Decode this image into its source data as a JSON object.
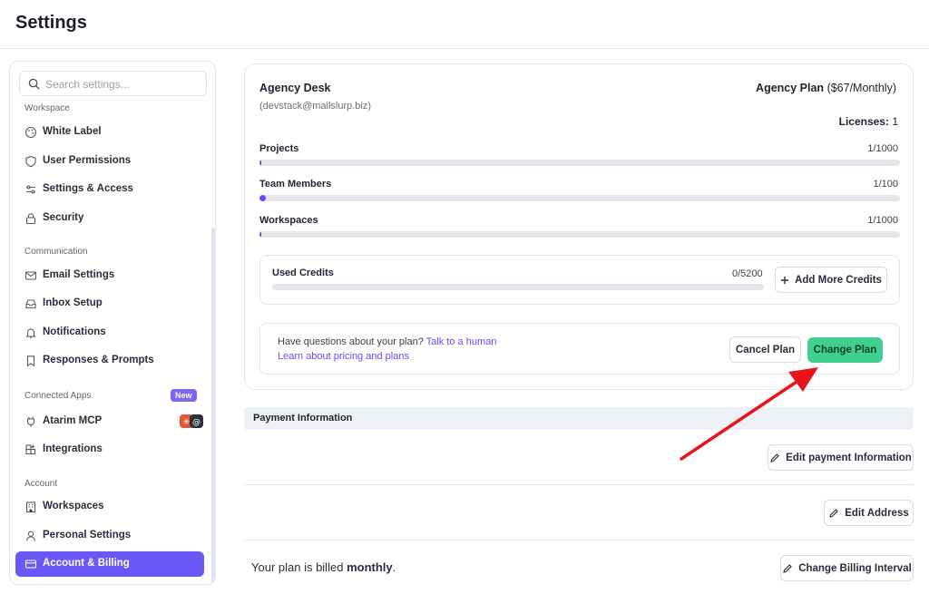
{
  "header": {
    "title": "Settings"
  },
  "sidebar": {
    "search_placeholder": "Search settings...",
    "sections": {
      "workspace": "Workspace",
      "communication": "Communication",
      "connected_apps": "Connected Apps",
      "account": "Account"
    },
    "new_badge": "New",
    "items": [
      {
        "label": "White Label",
        "icon": "palette-icon"
      },
      {
        "label": "User Permissions",
        "icon": "shield-icon"
      },
      {
        "label": "Settings & Access",
        "icon": "sliders-icon"
      },
      {
        "label": "Security",
        "icon": "lock-icon"
      },
      {
        "label": "Email Settings",
        "icon": "mail-icon"
      },
      {
        "label": "Inbox Setup",
        "icon": "inbox-icon"
      },
      {
        "label": "Notifications",
        "icon": "bell-icon"
      },
      {
        "label": "Responses & Prompts",
        "icon": "bookmark-icon"
      },
      {
        "label": "Atarim MCP",
        "icon": "plug-icon"
      },
      {
        "label": "Integrations",
        "icon": "grid-plus-icon"
      },
      {
        "label": "Workspaces",
        "icon": "building-icon"
      },
      {
        "label": "Personal Settings",
        "icon": "user-icon"
      },
      {
        "label": "Account & Billing",
        "icon": "card-icon",
        "active": true
      }
    ]
  },
  "plan_card": {
    "account_name": "Agency Desk",
    "account_email": "(devstack@mailslurp.biz)",
    "plan_name": "Agency Plan",
    "plan_price": "($67/Monthly)",
    "licenses_label": "Licenses:",
    "licenses_value": "1",
    "usage": [
      {
        "label": "Projects",
        "value": "1/1000",
        "fraction": 0.001
      },
      {
        "label": "Team Members",
        "value": "1/100",
        "fraction": 0.01
      },
      {
        "label": "Workspaces",
        "value": "1/1000",
        "fraction": 0.001
      }
    ],
    "credits": {
      "label": "Used Credits",
      "value": "0/5200",
      "fraction": 0,
      "button": "Add More Credits"
    },
    "help": {
      "question": "Have questions about your plan?",
      "talk_link": "Talk to a human",
      "pricing_link": "Learn about pricing and plans",
      "cancel_button": "Cancel Plan",
      "change_button": "Change Plan"
    }
  },
  "payment": {
    "section_title": "Payment Information",
    "edit_payment_button": "Edit payment Information",
    "edit_address_button": "Edit Address",
    "billed_prefix": "Your plan is billed",
    "billed_interval": "monthly",
    "billed_suffix": ".",
    "change_interval_button": "Change Billing Interval"
  },
  "colors": {
    "accent": "#6b57f5",
    "progress": "#5b4ff2",
    "primary_button": "#3fd08f",
    "annotation_arrow": "#e8141c"
  }
}
